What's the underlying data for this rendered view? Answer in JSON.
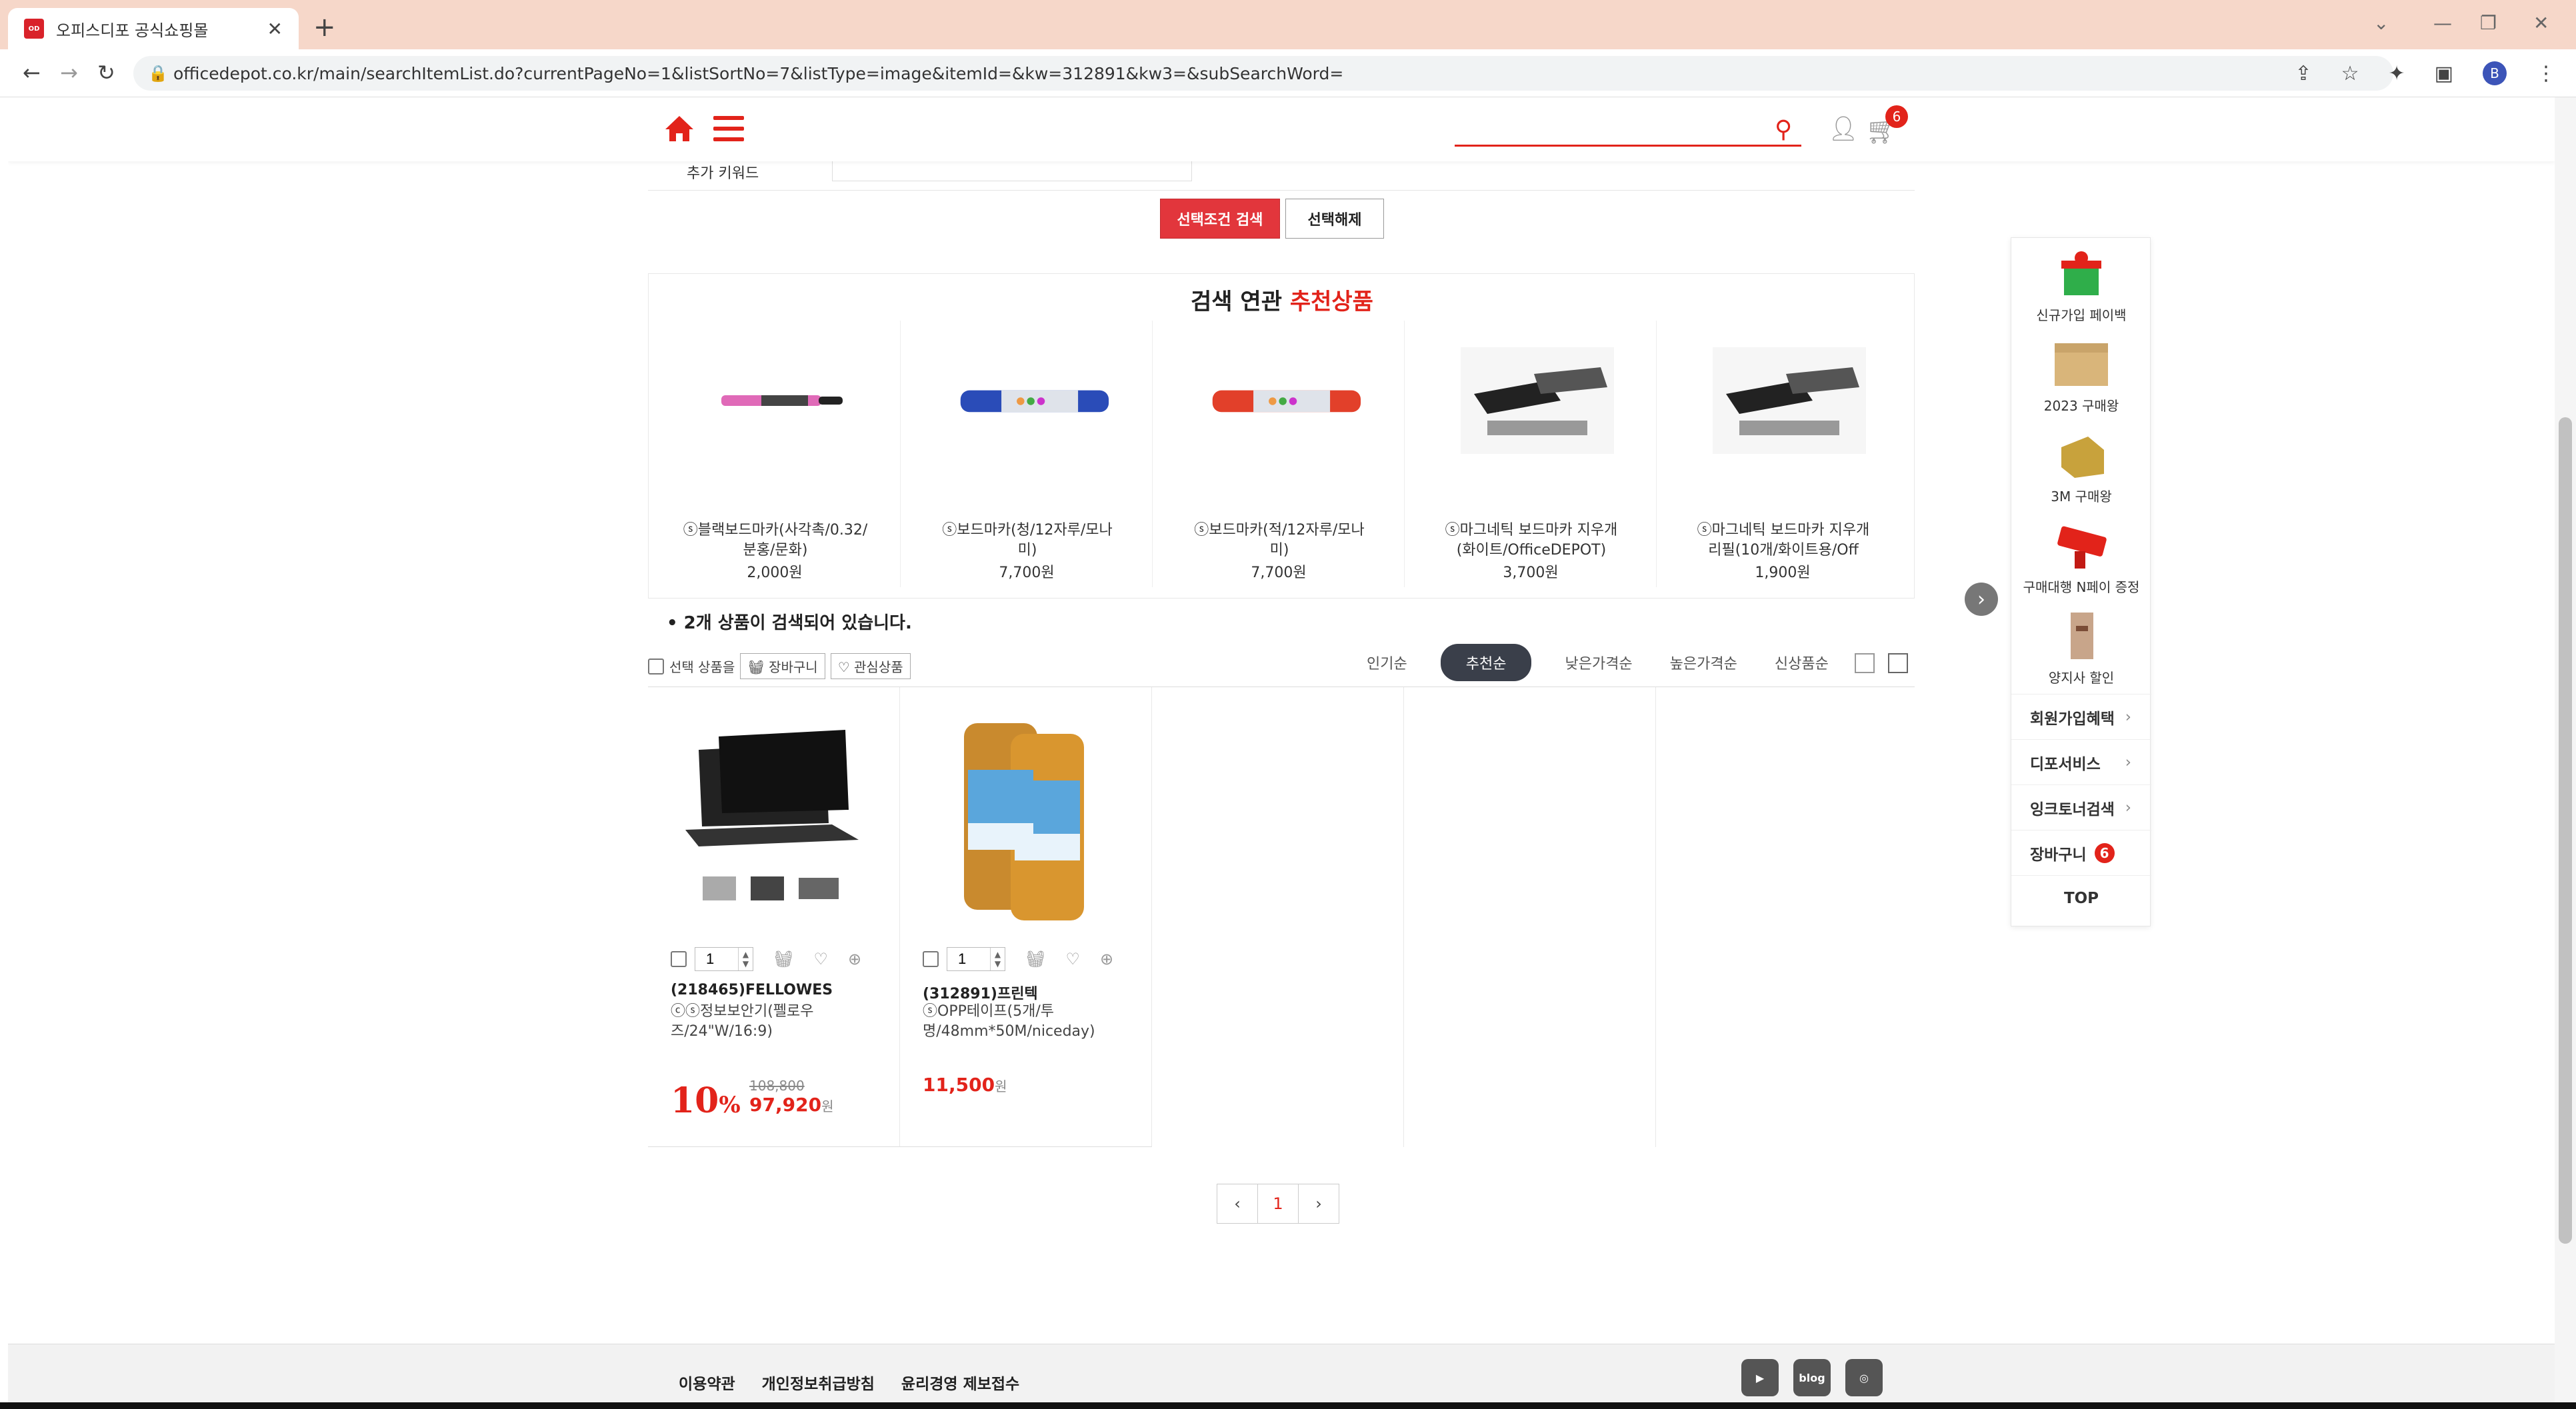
{
  "browser": {
    "tab_title": "오피스디포 공식쇼핑몰",
    "tab_close": "✕",
    "new_tab": "+",
    "url": "officedepot.co.kr/main/searchItemList.do?currentPageNo=1&listSortNo=7&listType=image&itemId=&kw=312891&kw3=&subSearchWord=",
    "profile_initial": "B"
  },
  "header": {
    "cart_count": "6",
    "search_placeholder": ""
  },
  "filter": {
    "keyword_label": "추가 키워드"
  },
  "buttons": {
    "select_search": "선택조건 검색",
    "clear_select": "선택해제"
  },
  "recommend": {
    "title_prefix": "검색 연관 ",
    "title_highlight": "추천상품",
    "items": [
      {
        "name": "ⓢ블랙보드마카(사각촉/0.32/분홍/문화)",
        "price": "2,000원"
      },
      {
        "name": "ⓢ보드마카(청/12자루/모나미)",
        "price": "7,700원"
      },
      {
        "name": "ⓢ보드마카(적/12자루/모나미)",
        "price": "7,700원"
      },
      {
        "name": "ⓢ마그네틱 보드마카 지우개(화이트/OfficeDEPOT)",
        "price": "3,700원"
      },
      {
        "name": "ⓢ마그네틱 보드마카 지우개 리필(10개/화이트용/Off",
        "price": "1,900원"
      }
    ]
  },
  "results": {
    "count_text": "• 2개 상품이 검색되어 있습니다.",
    "select_label": "선택 상품을",
    "cart_btn": "장바구니",
    "wish_btn": "관심상품",
    "sorts": [
      "인기순",
      "추천순",
      "낮은가격순",
      "높은가격순",
      "신상품순"
    ],
    "active_sort": "추천순"
  },
  "products": [
    {
      "qty": "1",
      "code": "(218465)FELLOWES",
      "name": "ⓒⓢ정보보안기(펠로우즈/24\"W/16:9)",
      "discount": "10",
      "discount_unit": "%",
      "orig_price": "108,800",
      "price": "97,920",
      "won": "원"
    },
    {
      "qty": "1",
      "code": "(312891)프린텍",
      "name": "ⓢOPP테이프(5개/투명/48mm*50M/niceday)",
      "price": "11,500",
      "won": "원"
    }
  ],
  "pagination": {
    "prev": "‹",
    "current": "1",
    "next": "›"
  },
  "quick_menu": {
    "items": [
      {
        "label": "신규가입 페이백"
      },
      {
        "label": "2023 구매왕"
      },
      {
        "label": "3M 구매왕"
      },
      {
        "label": "구매대행 N페이 증정"
      },
      {
        "label": "양지사 할인"
      }
    ],
    "links": [
      {
        "label": "회원가입혜택",
        "chev": "›"
      },
      {
        "label": "디포서비스",
        "chev": "›"
      },
      {
        "label": "잉크토너검색",
        "chev": "›"
      }
    ],
    "cart_label": "장바구니",
    "cart_count": "6",
    "top_label": "TOP"
  },
  "footer": {
    "links": [
      "이용약관",
      "개인정보취급방침",
      "윤리경영 제보접수"
    ],
    "social": [
      "▶",
      "blog",
      "◎"
    ]
  },
  "colors": {
    "brand_red": "#e2231a",
    "tab_bar": "#f6d7c9",
    "sort_active": "#3a3f4a"
  }
}
